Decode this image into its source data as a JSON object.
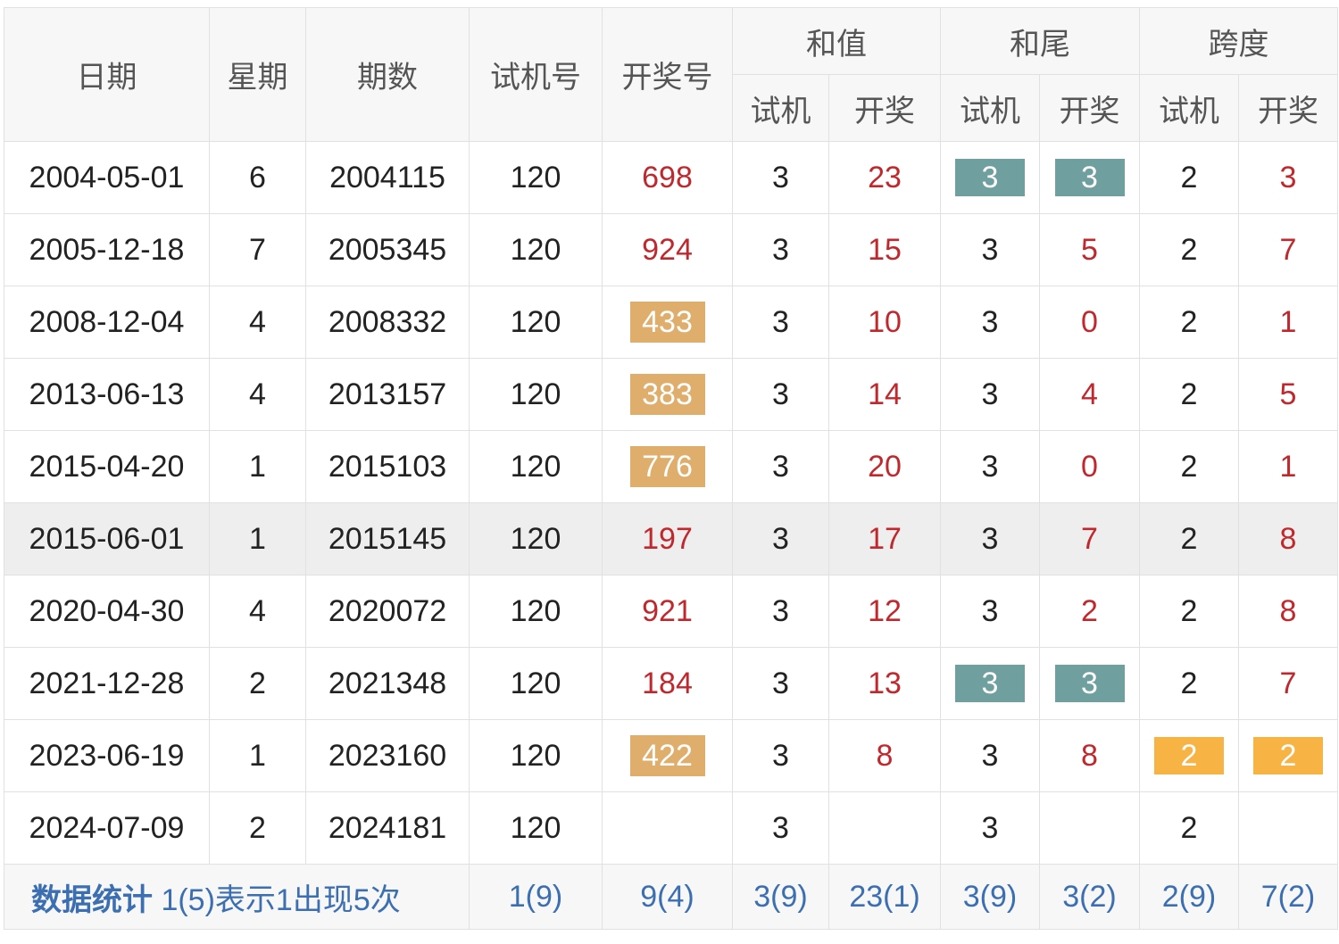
{
  "headers": {
    "date": "日期",
    "weekday": "星期",
    "period": "期数",
    "test_number": "试机号",
    "draw_number": "开奖号",
    "sum_group": "和值",
    "tail_group": "和尾",
    "span_group": "跨度",
    "sub_test": "试机",
    "sub_draw": "开奖"
  },
  "rows": [
    {
      "date": "2004-05-01",
      "weekday": "6",
      "period": "2004115",
      "test": "120",
      "draw": "698",
      "sum_test": "3",
      "sum_draw": "23",
      "tail_test": "3",
      "tail_draw": "3",
      "span_test": "2",
      "span_draw": "3"
    },
    {
      "date": "2005-12-18",
      "weekday": "7",
      "period": "2005345",
      "test": "120",
      "draw": "924",
      "sum_test": "3",
      "sum_draw": "15",
      "tail_test": "3",
      "tail_draw": "5",
      "span_test": "2",
      "span_draw": "7"
    },
    {
      "date": "2008-12-04",
      "weekday": "4",
      "period": "2008332",
      "test": "120",
      "draw": "433",
      "sum_test": "3",
      "sum_draw": "10",
      "tail_test": "3",
      "tail_draw": "0",
      "span_test": "2",
      "span_draw": "1"
    },
    {
      "date": "2013-06-13",
      "weekday": "4",
      "period": "2013157",
      "test": "120",
      "draw": "383",
      "sum_test": "3",
      "sum_draw": "14",
      "tail_test": "3",
      "tail_draw": "4",
      "span_test": "2",
      "span_draw": "5"
    },
    {
      "date": "2015-04-20",
      "weekday": "1",
      "period": "2015103",
      "test": "120",
      "draw": "776",
      "sum_test": "3",
      "sum_draw": "20",
      "tail_test": "3",
      "tail_draw": "0",
      "span_test": "2",
      "span_draw": "1"
    },
    {
      "date": "2015-06-01",
      "weekday": "1",
      "period": "2015145",
      "test": "120",
      "draw": "197",
      "sum_test": "3",
      "sum_draw": "17",
      "tail_test": "3",
      "tail_draw": "7",
      "span_test": "2",
      "span_draw": "8"
    },
    {
      "date": "2020-04-30",
      "weekday": "4",
      "period": "2020072",
      "test": "120",
      "draw": "921",
      "sum_test": "3",
      "sum_draw": "12",
      "tail_test": "3",
      "tail_draw": "2",
      "span_test": "2",
      "span_draw": "8"
    },
    {
      "date": "2021-12-28",
      "weekday": "2",
      "period": "2021348",
      "test": "120",
      "draw": "184",
      "sum_test": "3",
      "sum_draw": "13",
      "tail_test": "3",
      "tail_draw": "3",
      "span_test": "2",
      "span_draw": "7"
    },
    {
      "date": "2023-06-19",
      "weekday": "1",
      "period": "2023160",
      "test": "120",
      "draw": "422",
      "sum_test": "3",
      "sum_draw": "8",
      "tail_test": "3",
      "tail_draw": "8",
      "span_test": "2",
      "span_draw": "2"
    },
    {
      "date": "2024-07-09",
      "weekday": "2",
      "period": "2024181",
      "test": "120",
      "draw": "",
      "sum_test": "3",
      "sum_draw": "",
      "tail_test": "3",
      "tail_draw": "",
      "span_test": "2",
      "span_draw": ""
    }
  ],
  "stats": {
    "title": "数据统计",
    "note": "1(5)表示1出现5次",
    "test": "1(9)",
    "draw": "9(4)",
    "sum_test": "3(9)",
    "sum_draw": "23(1)",
    "tail_test": "3(9)",
    "tail_draw": "3(2)",
    "span_test": "2(9)",
    "span_draw": "7(2)"
  },
  "colors": {
    "red_text": "#c0282d",
    "teal_highlight": "#6f9f9f",
    "gold_highlight": "#e0ae6c",
    "orange_highlight": "#f7b344",
    "stats_blue": "#3c6fb1",
    "header_bg": "#f7f7f7",
    "row_highlight_bg": "#eeeeee"
  }
}
